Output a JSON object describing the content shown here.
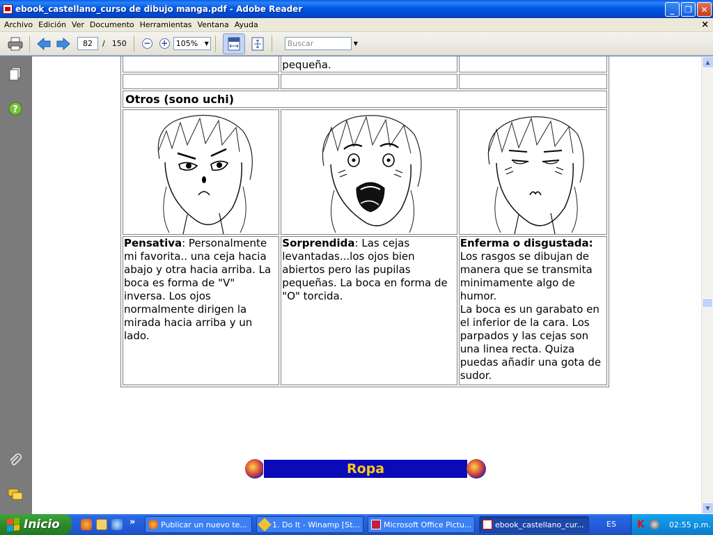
{
  "window": {
    "title": "ebook_castellano_curso de dibujo manga.pdf - Adobe Reader",
    "minimize": "_",
    "maximize": "❐",
    "close": "✕"
  },
  "menu": {
    "items": [
      "Archivo",
      "Edición",
      "Ver",
      "Documento",
      "Herramientas",
      "Ventana",
      "Ayuda"
    ],
    "doc_close": "×"
  },
  "toolbar": {
    "page_current": "82",
    "page_separator": "/",
    "page_total": "150",
    "zoom_out": "−",
    "zoom_in": "+",
    "zoom": "105%",
    "search_placeholder": "Buscar"
  },
  "document": {
    "top_row": [
      "",
      "pequeña.",
      ""
    ],
    "section_header": "Otros (sono uchi)",
    "expressions": [
      {
        "title": "Pensativa",
        "text": ": Personalmente mi favorita.. una ceja hacia abajo y otra hacia arriba. La boca es forma de \"V\" inversa. Los ojos normalmente dirigen la mirada hacia arriba y un lado."
      },
      {
        "title": "Sorprendida",
        "text": ": Las cejas levantadas...los ojos bien abiertos pero las pupilas pequeñas. La boca en forma de \"O\" torcida."
      },
      {
        "title": "Enferma o disgustada:",
        "text": " Los rasgos se dibujan de manera que se transmita minimamente algo de humor.\nLa boca es un garabato en el inferior de la cara. Los parpados y las cejas son una linea recta. Quiza puedas añadir una gota de sudor."
      }
    ],
    "banner": "Ropa"
  },
  "taskbar": {
    "start_label": "Inicio",
    "quicklaunch_more": "»",
    "tasks": [
      "Publicar un nuevo te...",
      "1. Do It - Winamp [St...",
      "Microsoft Office Pictu...",
      "ebook_castellano_cur..."
    ],
    "active_task": 3,
    "language": "ES",
    "clock": "02:55 p.m."
  }
}
